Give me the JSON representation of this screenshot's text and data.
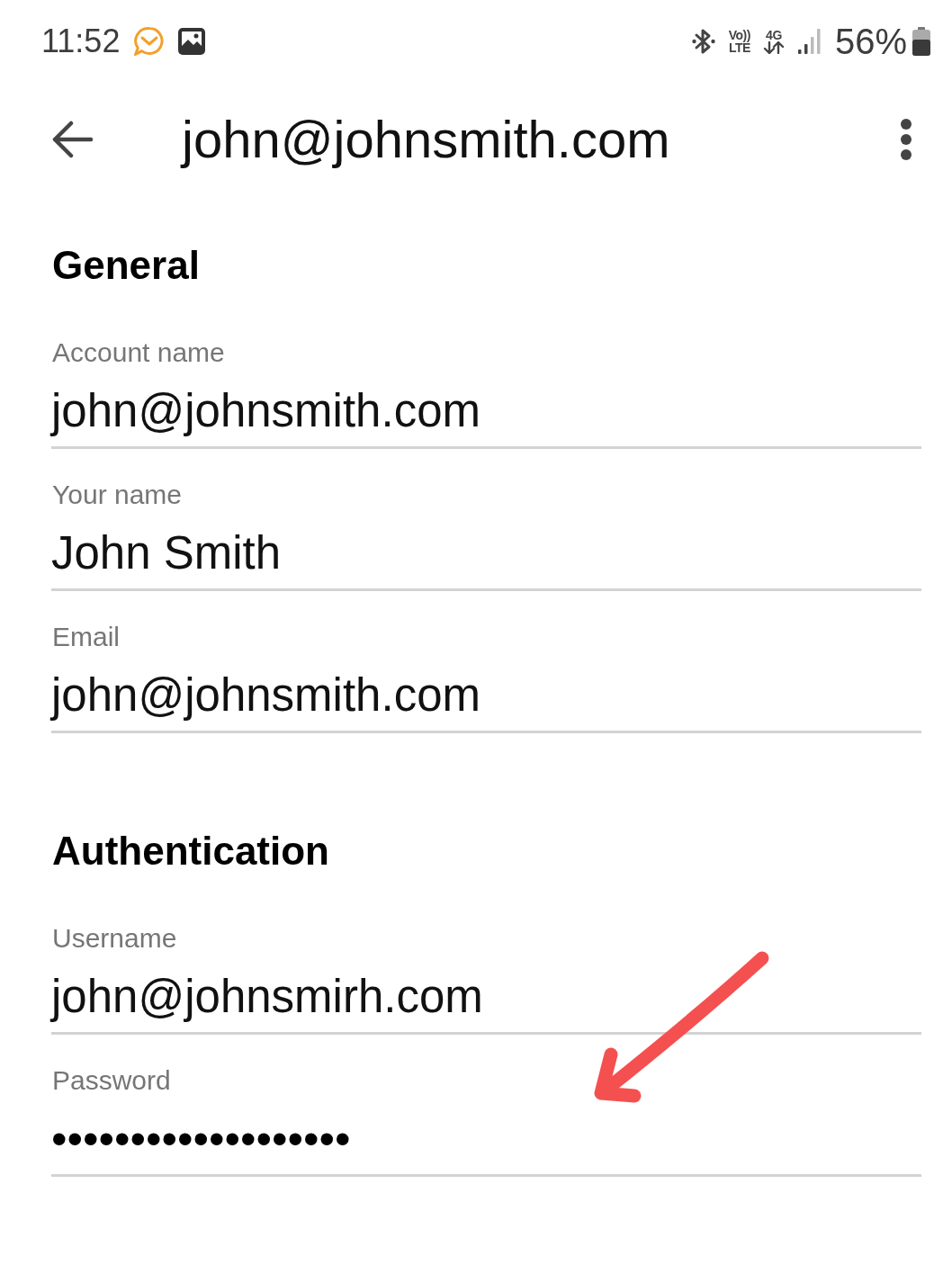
{
  "status_bar": {
    "time": "11:52",
    "volte": {
      "top": "Vo))",
      "bottom": "LTE"
    },
    "network": "4G",
    "battery": "56%"
  },
  "toolbar": {
    "title": "john@johnsmith.com"
  },
  "sections": [
    {
      "title": "General",
      "fields": [
        {
          "label": "Account name",
          "value": "john@johnsmith.com",
          "kind": "text"
        },
        {
          "label": "Your name",
          "value": "John Smith",
          "kind": "text"
        },
        {
          "label": "Email",
          "value": "john@johnsmith.com",
          "kind": "text"
        }
      ]
    },
    {
      "title": "Authentication",
      "fields": [
        {
          "label": "Username",
          "value": "john@johnsmirh.com",
          "kind": "text"
        },
        {
          "label": "Password",
          "value": "•••••••••••••••••••",
          "kind": "password"
        }
      ]
    }
  ]
}
